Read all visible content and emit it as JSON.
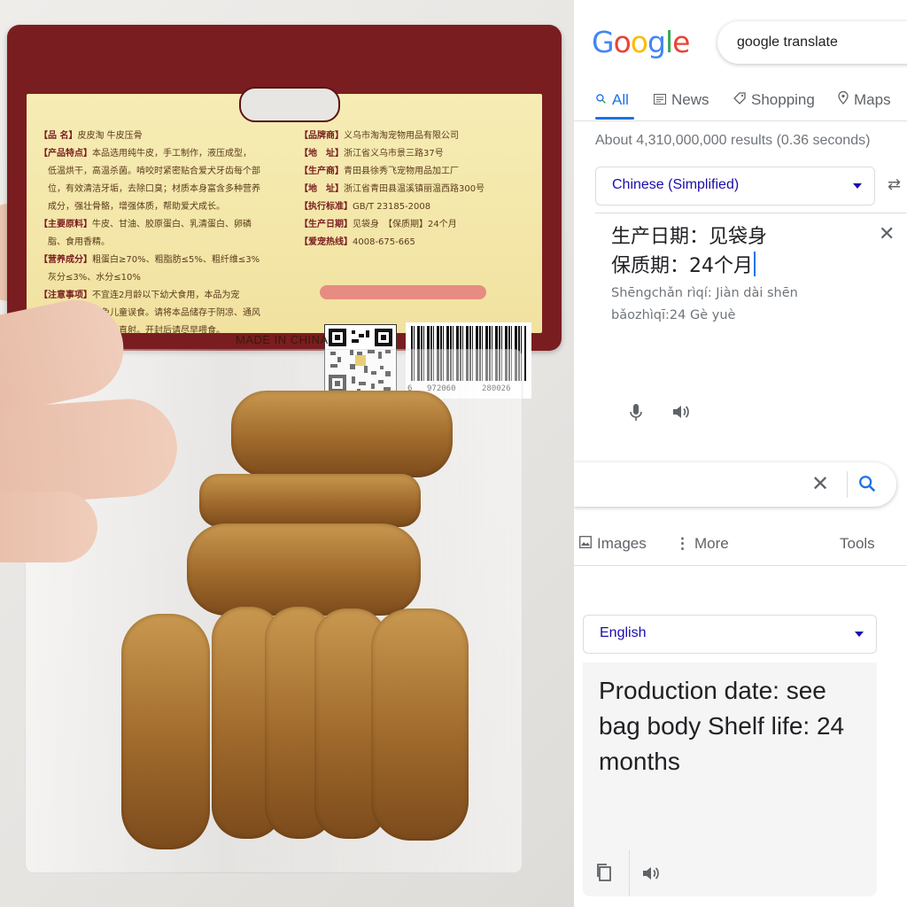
{
  "photo": {
    "label_lines_left": [
      {
        "key": "【品 名】",
        "text": "皮皮淘 牛皮压骨"
      },
      {
        "key": "【产品特点】",
        "text": "本品选用纯牛皮，手工制作，液压成型，"
      },
      {
        "key": "",
        "text": "低温烘干，高温杀菌。啃咬时紧密贴合爱犬牙齿每个部"
      },
      {
        "key": "",
        "text": "位，有效清洁牙垢，去除口臭；材质本身富含多种营养"
      },
      {
        "key": "",
        "text": "成分，强壮骨骼，增强体质，帮助爱犬成长。"
      },
      {
        "key": "【主要原料】",
        "text": "牛皮、甘油、胶原蛋白、乳清蛋白、卵磷"
      },
      {
        "key": "",
        "text": "脂、食用香精。"
      },
      {
        "key": "【营养成分】",
        "text": "粗蛋白≥70%、粗脂肪≤5%、粗纤维≤3%"
      },
      {
        "key": "",
        "text": "灰分≤3%、水分≤10%"
      },
      {
        "key": "【注意事项】",
        "text": "不宜连2月龄以下幼犬食用，本品为宠"
      },
      {
        "key": "",
        "text": "物咬胶，请避免儿童误食。请将本品储存于阴凉、通风"
      },
      {
        "key": "",
        "text": "干燥处，避免阳光直射。开封后请尽早喂食。"
      }
    ],
    "label_lines_right": [
      {
        "key": "【品牌商】",
        "text": "义乌市淘淘宠物用品有限公司"
      },
      {
        "key": "【地　址】",
        "text": "浙江省义乌市景三路37号"
      },
      {
        "key": "【生产商】",
        "text": "青田县徐秀飞宠物用品加工厂"
      },
      {
        "key": "【地　址】",
        "text": "浙江省青田县温溪镇丽温西路300号"
      },
      {
        "key": "【执行标准】",
        "text": "GB/T 23185-2008"
      },
      {
        "key": "【生产日期】",
        "text": "见袋身　【保质期】24个月"
      },
      {
        "key": "【爱宠热线】",
        "text": "4008-675-665"
      }
    ],
    "barcode_left": "6",
    "barcode_mid": "972060",
    "barcode_right": "280026",
    "made_in": "MADE IN CHINA"
  },
  "google": {
    "logo": [
      {
        "ch": "G",
        "color": "#4285F4"
      },
      {
        "ch": "o",
        "color": "#EA4335"
      },
      {
        "ch": "o",
        "color": "#FBBC05"
      },
      {
        "ch": "g",
        "color": "#4285F4"
      },
      {
        "ch": "l",
        "color": "#34A853"
      },
      {
        "ch": "e",
        "color": "#EA4335"
      }
    ],
    "search_query": "google translate",
    "tabs": {
      "all": "All",
      "news": "News",
      "shopping": "Shopping",
      "maps": "Maps"
    },
    "result_stats": "About 4,310,000,000 results (0.36 seconds)",
    "source_language": "Chinese (Simplified)",
    "source_text_line1": "生产日期：见袋身",
    "source_text_line2": "保质期：24个月",
    "transliteration_line1": "Shēngchǎn rìqí: Jiàn dài shēn",
    "transliteration_line2": "bǎozhìqī:24 Gè yuè",
    "tabs2": {
      "images": "Images",
      "more": "More",
      "tools": "Tools"
    },
    "target_language": "English",
    "translation": "Production date: see bag body Shelf life: 24 months",
    "accent_color": "#1a73e8",
    "link_color": "#1a0dab"
  }
}
